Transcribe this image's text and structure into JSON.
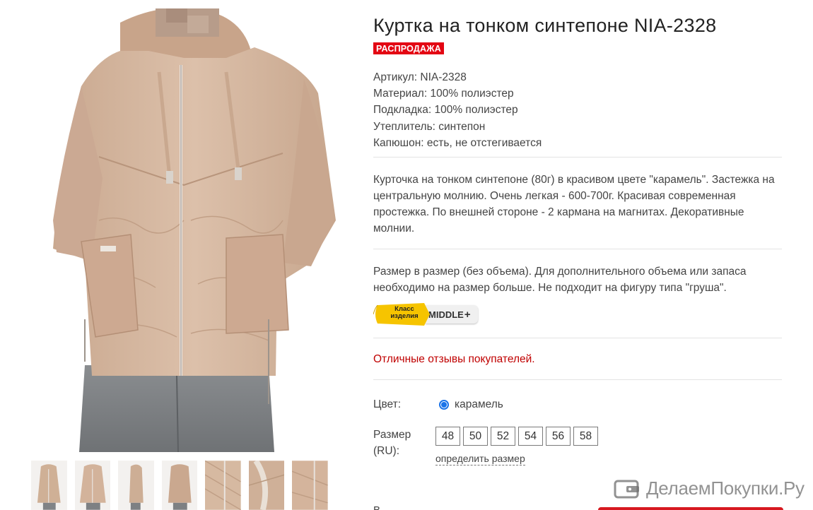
{
  "product": {
    "title": "Куртка на тонком синтепоне NIA-2328",
    "badge": "РАСПРОДАЖА",
    "specs": [
      "Артикул: NIA-2328",
      "Материал: 100% полиэстер",
      "Подкладка: 100% полиэстер",
      "Утеплитель: синтепон",
      "Капюшон: есть, не отстегивается"
    ],
    "description": "Курточка на тонком синтепоне (80г) в красивом цвете \"карамель\". Застежка на центральную молнию. Очень легкая - 600-700г. Красивая современная простежка. По внешней стороне - 2 кармана на магнитах. Декоративные молнии.",
    "size_note": "Размер в размер (без объема). Для дополнительного объема или запаса необходимо на размер больше. Не подходит на фигуру типа \"груша\".",
    "class_badge": {
      "left_line1": "Класс",
      "left_line2": "изделия",
      "right": "MIDDLE",
      "plus": "+"
    },
    "reviews": "Отличные отзывы покупателей.",
    "color": {
      "label": "Цвет:",
      "selected": "карамель"
    },
    "size": {
      "label_line1": "Размер",
      "label_line2": "(RU):",
      "options": [
        "48",
        "50",
        "52",
        "54",
        "56",
        "58"
      ],
      "link": "определить размер"
    },
    "bottom_cut_label": "В"
  },
  "gallery": {
    "thumbnail_count": 7
  },
  "watermark": {
    "text": "ДелаемПокупки.Ру"
  },
  "colors": {
    "sale_red": "#e30613",
    "jacket_beige": "#d8b9a1",
    "review_red": "#c00000",
    "radio_blue": "#1a73e8",
    "badge_yellow": "#f6c400"
  }
}
